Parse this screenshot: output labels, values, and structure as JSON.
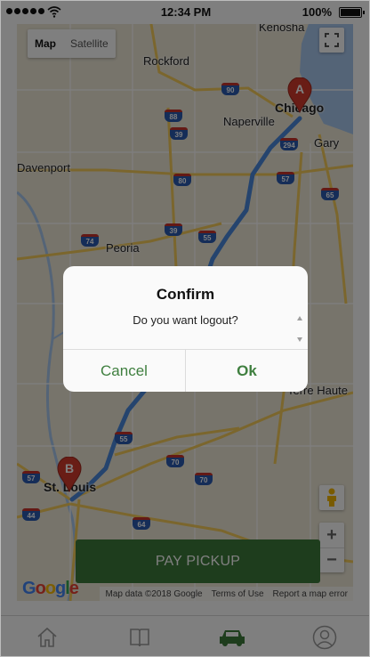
{
  "status_bar": {
    "time": "12:34 PM",
    "battery": "100%",
    "icons": [
      "signal-dots-icon",
      "wifi-icon",
      "battery-icon"
    ]
  },
  "map": {
    "type_options": [
      {
        "label": "Map",
        "selected": true
      },
      {
        "label": "Satellite",
        "selected": false
      }
    ],
    "controls": [
      "fullscreen-icon",
      "pegman-icon",
      "zoom-in-icon",
      "zoom-out-icon"
    ],
    "zoom_in": "+",
    "zoom_out": "−",
    "cities": [
      "Kenosha",
      "Rockford",
      "Naperville",
      "Chicago",
      "Gary",
      "Davenport",
      "Peoria",
      "Terre Haute",
      "St. Louis"
    ],
    "interstates": [
      "90",
      "88",
      "39",
      "294",
      "57",
      "80",
      "65",
      "74",
      "39",
      "55",
      "55",
      "70",
      "70",
      "64",
      "44",
      "57"
    ],
    "markers": [
      {
        "letter": "A",
        "place": "Chicago",
        "color": "#d33a2c"
      },
      {
        "letter": "B",
        "place": "St. Louis",
        "color": "#d33a2c"
      }
    ],
    "route_color": "#4a89dc",
    "logo": "Google",
    "attribution": [
      "Map data ©2018 Google",
      "Terms of Use",
      "Report a map error"
    ]
  },
  "actions": {
    "pay_pickup": "PAY PICKUP",
    "color": "#3d7a3a"
  },
  "bottom_nav": {
    "items": [
      "home-icon",
      "book-icon",
      "car-icon",
      "profile-icon"
    ],
    "active": "car-icon",
    "active_color": "#3d7a3a"
  },
  "dialog": {
    "title": "Confirm",
    "message": "Do you want logout?",
    "cancel_label": "Cancel",
    "ok_label": "Ok",
    "accent": "#3f7f3f"
  }
}
